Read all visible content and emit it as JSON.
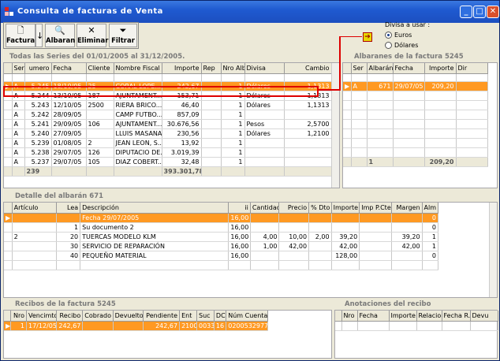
{
  "window": {
    "title": "Consulta de facturas de Venta"
  },
  "toolbar": {
    "factura": "Factura",
    "albaran": "Albaran",
    "eliminar": "Eliminar",
    "filtrar": "Filtrar"
  },
  "divisa": {
    "label": "Divisa a usar :",
    "euros": "Euros",
    "dolares": "Dólares",
    "selected": "Euros"
  },
  "facturas": {
    "title": "Todas las Series  del 01/01/2005 al 31/12/2005.",
    "headers": [
      "Ser",
      "umero",
      "Fecha",
      "Cliente",
      "Nombre Fiscal",
      "Importe",
      "Rep",
      "Nro Alb",
      "Divisa",
      "Cambio"
    ],
    "rows": [
      [
        "A",
        "5.245",
        "18/10/05",
        "25",
        "CORAL LOPE...",
        "242,67",
        "",
        "1",
        "Dólares",
        "1,1313"
      ],
      [
        "A",
        "5.244",
        "13/10/05",
        "187",
        "AJUNTAMENT...",
        "153,71",
        "",
        "1",
        "Dólares",
        "1,1313"
      ],
      [
        "A",
        "5.243",
        "12/10/05",
        "2500",
        "RIERA BRICO...",
        "46,40",
        "",
        "1",
        "Dólares",
        "1,1313"
      ],
      [
        "A",
        "5.242",
        "28/09/05",
        "",
        "CAMP FUTBO...",
        "857,09",
        "",
        "1",
        "",
        ""
      ],
      [
        "A",
        "5.241",
        "29/09/05",
        "106",
        "AJUNTAMENT...",
        "30.676,56",
        "",
        "1",
        "Pesos",
        "2,5700"
      ],
      [
        "A",
        "5.240",
        "27/09/05",
        "",
        "LLUIS MASANA",
        "230,56",
        "",
        "1",
        "Dólares",
        "1,2100"
      ],
      [
        "A",
        "5.239",
        "01/08/05",
        "2",
        "JEAN LEON, S...",
        "13,92",
        "",
        "1",
        "",
        ""
      ],
      [
        "A",
        "5.238",
        "29/07/05",
        "126",
        "DIPUTACIO DE...",
        "3.019,39",
        "",
        "1",
        "",
        ""
      ],
      [
        "A",
        "5.237",
        "29/07/05",
        "105",
        "DIAZ COBERT...",
        "32,48",
        "",
        "1",
        "",
        ""
      ]
    ],
    "footer_count": "239",
    "footer_total": "393.301,78"
  },
  "albaranes": {
    "title": "Albaranes de la factura 5245",
    "headers": [
      "Ser",
      "Albarán",
      "Fecha",
      "Importe",
      "Dir"
    ],
    "rows": [
      [
        "A",
        "671",
        "29/07/05",
        "209,20",
        ""
      ]
    ],
    "footer_count": "1",
    "footer_total": "209,20"
  },
  "detalle": {
    "title": "Detalle del albarán 671",
    "headers": [
      "Artículo",
      "Lea",
      "Descripción",
      "ii",
      "Cantidad",
      "Precio",
      "% Dto",
      "Importe",
      "Imp P.Cte",
      "Margen",
      "Alm"
    ],
    "rows": [
      [
        "",
        "",
        "Fecha  29/07/2005",
        "16,00",
        "",
        "",
        "",
        "",
        "",
        "",
        "0"
      ],
      [
        "",
        "1",
        "Su documento 2",
        "16,00",
        "",
        "",
        "",
        "",
        "",
        "",
        "0"
      ],
      [
        "2",
        "20",
        "TUERCAS MODELO KLM",
        "16,00",
        "4,00",
        "10,00",
        "2,00",
        "39,20",
        "",
        "39,20",
        "1"
      ],
      [
        "",
        "30",
        "SERVICIO DE REPARACIÓN",
        "16,00",
        "1,00",
        "42,00",
        "",
        "42,00",
        "",
        "42,00",
        "1"
      ],
      [
        "",
        "40",
        "PEQUEÑO MATERIAL",
        "16,00",
        "",
        "",
        "",
        "128,00",
        "",
        "",
        "0"
      ]
    ]
  },
  "recibos": {
    "title": "Recibos de la factura  5245",
    "headers": [
      "Nro",
      "Vencimto",
      "Recibo",
      "Cobrado",
      "Devuelto",
      "Pendiente",
      "Ent",
      "Suc",
      "DC",
      "Núm Cuenta"
    ],
    "rows": [
      [
        "1",
        "17/12/05",
        "242,67",
        "",
        "",
        "242,67",
        "2100",
        "0033",
        "16",
        "0200532977"
      ]
    ]
  },
  "anotaciones": {
    "title": "Anotaciones del recibo",
    "headers": [
      "Nro",
      "Fecha",
      "Importe",
      "Relacion",
      "Fecha R.",
      "Devu"
    ]
  }
}
